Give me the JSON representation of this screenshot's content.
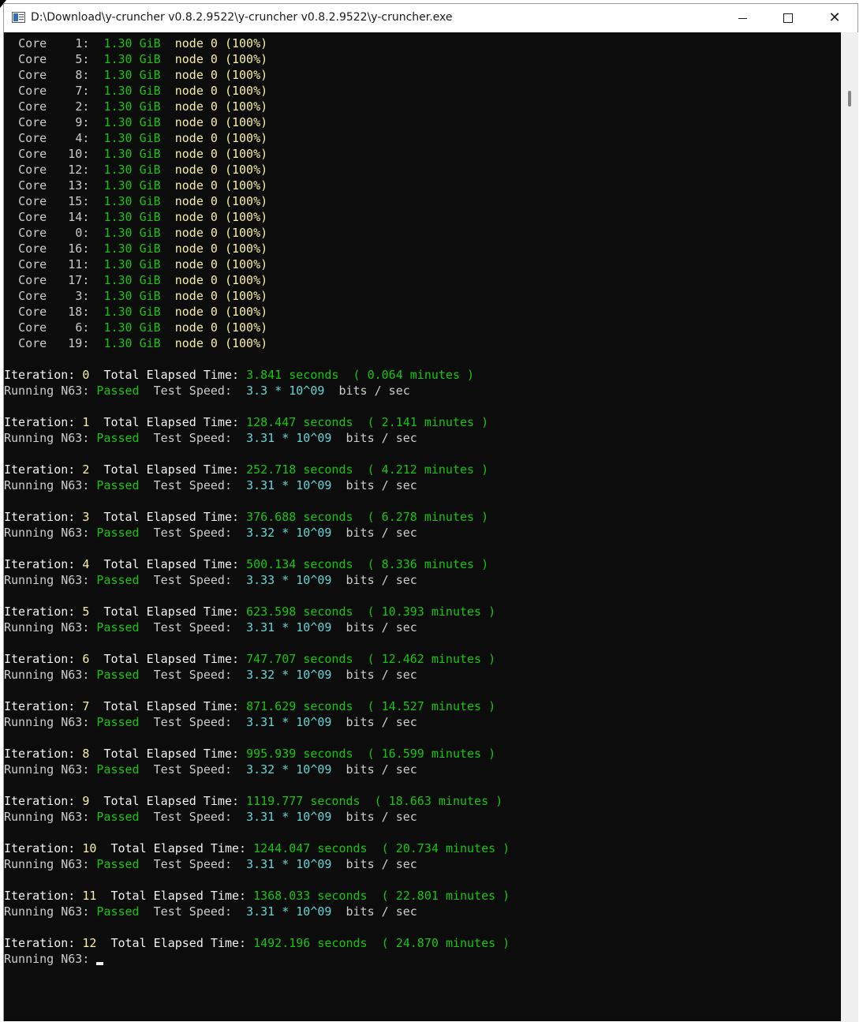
{
  "window": {
    "title": "D:\\Download\\y-cruncher v0.8.2.9522\\y-cruncher v0.8.2.9522\\y-cruncher.exe",
    "controls": [
      "minimize",
      "maximize",
      "close"
    ],
    "close_glyph": "✕"
  },
  "console": {
    "colors": {
      "background": "#0c0c0c",
      "default_text": "#cccccc",
      "green": "#16c60c",
      "yellow": "#f9f1a5",
      "cyan": "#61d6d6",
      "white": "#f2f2f2"
    },
    "core_label": "Core",
    "allocation": "1.30 GiB",
    "node_label": "node 0",
    "node_percent": "(100%)",
    "cores": [
      "1",
      "5",
      "8",
      "7",
      "2",
      "9",
      "4",
      "10",
      "12",
      "13",
      "15",
      "14",
      "0",
      "16",
      "11",
      "17",
      "3",
      "18",
      "6",
      "19"
    ],
    "iteration_label": "Iteration:",
    "elapsed_label": "Total Elapsed Time:",
    "seconds_unit": "seconds",
    "open_paren": "(",
    "minutes_unit": "minutes )",
    "running_label": "Running N63:",
    "status": "Passed",
    "speed_label": "Test Speed:",
    "speed_suffix": "* 10^09",
    "speed_unit": "bits / sec",
    "iterations": [
      {
        "n": "0",
        "seconds": "3.841",
        "minutes": "0.064",
        "speed": "3.3"
      },
      {
        "n": "1",
        "seconds": "128.447",
        "minutes": "2.141",
        "speed": "3.31"
      },
      {
        "n": "2",
        "seconds": "252.718",
        "minutes": "4.212",
        "speed": "3.31"
      },
      {
        "n": "3",
        "seconds": "376.688",
        "minutes": "6.278",
        "speed": "3.32"
      },
      {
        "n": "4",
        "seconds": "500.134",
        "minutes": "8.336",
        "speed": "3.33"
      },
      {
        "n": "5",
        "seconds": "623.598",
        "minutes": "10.393",
        "speed": "3.31"
      },
      {
        "n": "6",
        "seconds": "747.707",
        "minutes": "12.462",
        "speed": "3.32"
      },
      {
        "n": "7",
        "seconds": "871.629",
        "minutes": "14.527",
        "speed": "3.31"
      },
      {
        "n": "8",
        "seconds": "995.939",
        "minutes": "16.599",
        "speed": "3.32"
      },
      {
        "n": "9",
        "seconds": "1119.777",
        "minutes": "18.663",
        "speed": "3.31"
      },
      {
        "n": "10",
        "seconds": "1244.047",
        "minutes": "20.734",
        "speed": "3.31"
      },
      {
        "n": "11",
        "seconds": "1368.033",
        "minutes": "22.801",
        "speed": "3.31"
      },
      {
        "n": "12",
        "seconds": "1492.196",
        "minutes": "24.870",
        "speed": null
      }
    ]
  }
}
